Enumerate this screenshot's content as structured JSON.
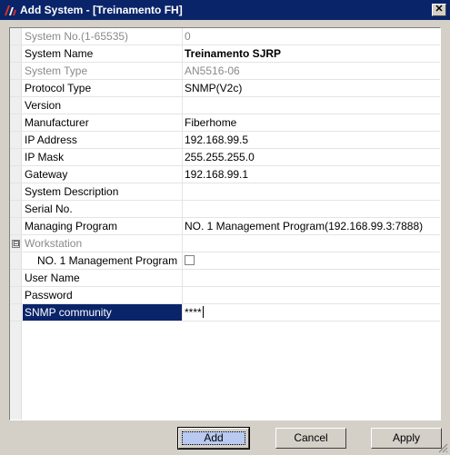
{
  "window": {
    "title": "Add System - [Treinamento FH]",
    "close_glyph": "✕"
  },
  "properties": [
    {
      "name": "System No.(1-65535)",
      "value": "0",
      "disabled": true
    },
    {
      "name": "System Name",
      "value": "Treinamento SJRP",
      "bold": true
    },
    {
      "name": "System Type",
      "value": "AN5516-06",
      "disabled": true
    },
    {
      "name": "Protocol Type",
      "value": "SNMP(V2c)"
    },
    {
      "name": "Version",
      "value": ""
    },
    {
      "name": "Manufacturer",
      "value": "Fiberhome"
    },
    {
      "name": "IP Address",
      "value": "192.168.99.5"
    },
    {
      "name": "IP Mask",
      "value": "255.255.255.0"
    },
    {
      "name": "Gateway",
      "value": "192.168.99.1"
    },
    {
      "name": "System Description",
      "value": ""
    },
    {
      "name": "Serial No.",
      "value": ""
    },
    {
      "name": "Managing Program",
      "value": "NO. 1 Management Program(192.168.99.3:7888)"
    },
    {
      "name": "Workstation",
      "value": "",
      "disabled": true,
      "category": true,
      "expander": "⊟"
    },
    {
      "name": "NO. 1 Management Program",
      "value": "",
      "checkbox": true,
      "checked": false
    },
    {
      "name": "User Name",
      "value": ""
    },
    {
      "name": "Password",
      "value": ""
    },
    {
      "name": "SNMP community",
      "value": "****",
      "selected": true
    }
  ],
  "buttons": {
    "add": "Add",
    "cancel": "Cancel",
    "apply": "Apply"
  },
  "colors": {
    "title_bar": "#0a246a",
    "selection": "#0a246a",
    "dialog_bg": "#d4d0c8",
    "disabled_text": "#8a8a8a"
  }
}
